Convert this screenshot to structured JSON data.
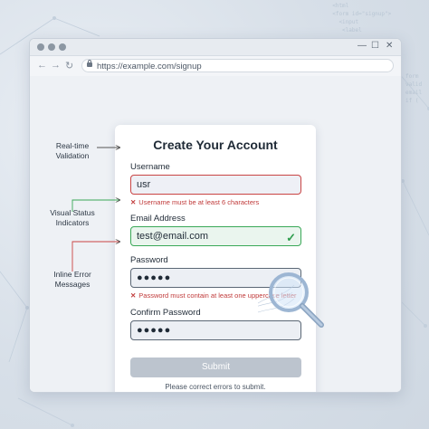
{
  "browser": {
    "url": "https://example.com/signup",
    "controls": {
      "minimize": "—",
      "maximize": "☐",
      "close": "✕"
    },
    "nav": {
      "back": "←",
      "forward": "→",
      "reload": "↻"
    }
  },
  "form": {
    "title": "Create Your Account",
    "username": {
      "label": "Username",
      "value": "usr",
      "error": "Username must be at least 6 characters",
      "status": "error"
    },
    "email": {
      "label": "Email Address",
      "value": "test@email.com",
      "status": "valid"
    },
    "password": {
      "label": "Password",
      "value": "●●●●●",
      "error": "Password must contain at least one uppercase letter",
      "status": "error"
    },
    "confirm": {
      "label": "Confirm Password",
      "value": "●●●●●",
      "status": "neutral"
    },
    "submit_label": "Submit",
    "hint": "Please correct errors to submit.",
    "error_mark": "✕",
    "valid_mark": "✓"
  },
  "annotations": {
    "realtime": "Real-time Validation",
    "visual_status": "Visual Status Indicators",
    "inline_errors": "Inline Error Messages"
  },
  "colors": {
    "error": "#c94444",
    "valid": "#3aa857",
    "submit_disabled": "#bcc4ce"
  }
}
